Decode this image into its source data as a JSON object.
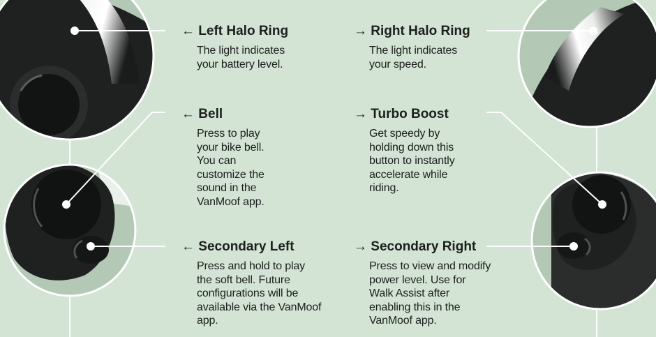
{
  "labels": {
    "left_halo": {
      "arrow": "←",
      "title": "Left Halo Ring",
      "description": "The light indicates your battery level."
    },
    "right_halo": {
      "arrow": "→",
      "title": "Right Halo Ring",
      "description": "The light indicates your speed."
    },
    "bell": {
      "arrow": "←",
      "title": "Bell",
      "description": "Press to play your bike bell. You can customize the sound in the VanMoof app."
    },
    "turbo": {
      "arrow": "→",
      "title": "Turbo Boost",
      "description": "Get speedy by holding down this button to instantly accelerate while riding."
    },
    "secondary_left": {
      "arrow": "←",
      "title": "Secondary Left",
      "description": "Press and hold to play the soft bell. Future configurations will be available via the VanMoof app."
    },
    "secondary_right": {
      "arrow": "→",
      "title": "Secondary Right",
      "description": "Press to view and modify power level. Use for Walk Assist after enabling this in the VanMoof app."
    }
  },
  "colors": {
    "background": "#d3e3d4",
    "circle_fill": "#b3c9b6",
    "device_dark": "#1e2120",
    "leader_line": "#ffffff"
  },
  "icons": [
    "left-halo-closeup",
    "left-buttons-closeup",
    "right-halo-closeup",
    "right-buttons-closeup"
  ]
}
